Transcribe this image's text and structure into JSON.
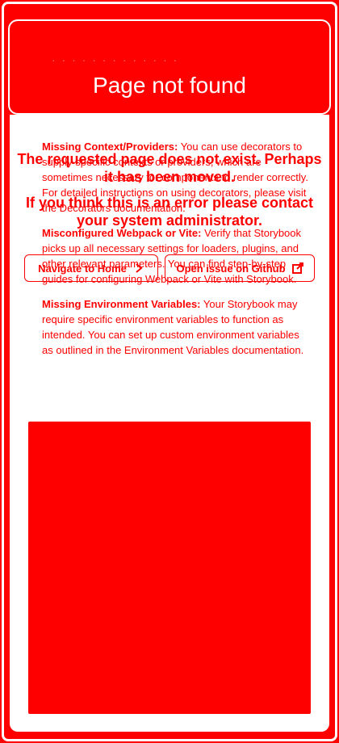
{
  "header": {
    "breadcrumb": "· · · · ·  · · · · · ·  · ·",
    "title": "Page not found"
  },
  "message": {
    "line1": "The requested page does not exist. Perhaps it has been moved.",
    "line2": "If you think this is an error please contact your system administrator."
  },
  "actions": {
    "home_label": "Navigate to Home",
    "github_label": "Open issue on Github"
  },
  "help": {
    "items": [
      {
        "term": "Missing Context/Providers:",
        "desc": " You can use decorators to supply specific contexts or providers, which are sometimes necessary for components to render correctly. For detailed instructions on using decorators, please visit the Decorators documentation."
      },
      {
        "term": "Misconfigured Webpack or Vite:",
        "desc": " Verify that Storybook picks up all necessary settings for loaders, plugins, and other relevant parameters. You can find step-by-step guides for configuring Webpack or Vite with Storybook."
      },
      {
        "term": "Missing Environment Variables:",
        "desc": " Your Storybook may require specific environment variables to function as intended. You can set up custom environment variables as outlined in the Environment Variables documentation."
      }
    ]
  },
  "icons": {
    "home_chevron": "chevron-right-icon",
    "github_external": "external-link-icon"
  },
  "colors": {
    "accent": "#ff0000",
    "surface": "#ffffff"
  }
}
